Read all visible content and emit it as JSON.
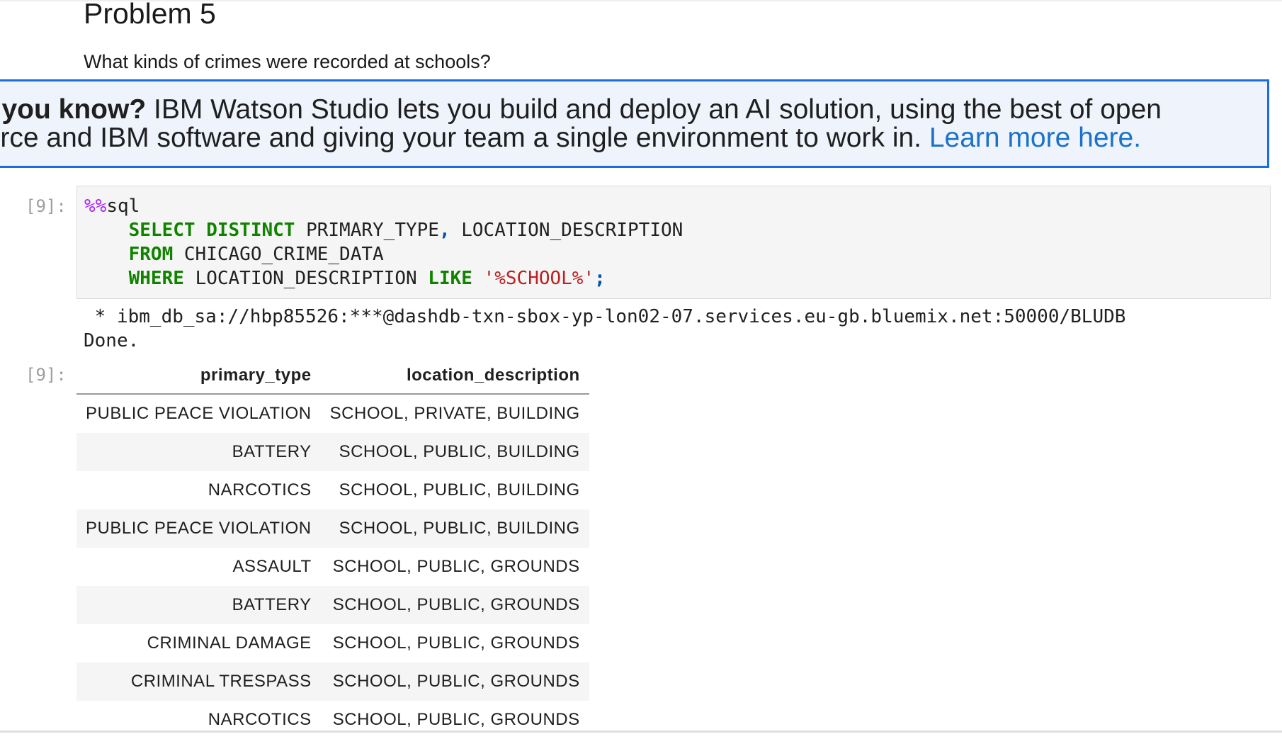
{
  "notebook": {
    "heading": "Problem 5",
    "question": "What kinds of crimes were recorded at schools?",
    "banner": {
      "line1_bold": "id you know?",
      "line1_rest": " IBM Watson Studio lets you build and deploy an AI solution, using the best of open",
      "line2_text": "ource and IBM software and giving your team a single environment to work in. ",
      "link_text": "Learn more here."
    },
    "code_cell": {
      "prompt": "[9]:",
      "magic_symbol": "%%",
      "magic_name": "sql",
      "indent": "    ",
      "kw_select": "SELECT",
      "kw_distinct": "DISTINCT",
      "col_primary": "PRIMARY_TYPE",
      "comma": ",",
      "col_location": "LOCATION_DESCRIPTION",
      "kw_from": "FROM",
      "table_name": "CHICAGO_CRIME_DATA",
      "kw_where": "WHERE",
      "where_column": "LOCATION_DESCRIPTION",
      "kw_like": "LIKE",
      "pattern": "'%SCHOOL%'",
      "semicolon": ";"
    },
    "output": {
      "connection": " * ibm_db_sa://hbp85526:***@dashdb-txn-sbox-yp-lon02-07.services.eu-gb.bluemix.net:50000/BLUDB",
      "status": "Done.",
      "prompt": "[9]:",
      "columns": [
        "primary_type",
        "location_description"
      ],
      "rows": [
        [
          "PUBLIC PEACE VIOLATION",
          "SCHOOL, PRIVATE, BUILDING"
        ],
        [
          "BATTERY",
          "SCHOOL, PUBLIC, BUILDING"
        ],
        [
          "NARCOTICS",
          "SCHOOL, PUBLIC, BUILDING"
        ],
        [
          "PUBLIC PEACE VIOLATION",
          "SCHOOL, PUBLIC, BUILDING"
        ],
        [
          "ASSAULT",
          "SCHOOL, PUBLIC, GROUNDS"
        ],
        [
          "BATTERY",
          "SCHOOL, PUBLIC, GROUNDS"
        ],
        [
          "CRIMINAL DAMAGE",
          "SCHOOL, PUBLIC, GROUNDS"
        ],
        [
          "CRIMINAL TRESPASS",
          "SCHOOL, PUBLIC, GROUNDS"
        ],
        [
          "NARCOTICS",
          "SCHOOL, PUBLIC, GROUNDS"
        ]
      ]
    }
  },
  "colors": {
    "keyword": "#118200",
    "magic": "#aa22ff",
    "string": "#ba2121",
    "link": "#1a73c8",
    "banner_border": "#1a6ee0",
    "banner_bg": "#eef3fc"
  }
}
